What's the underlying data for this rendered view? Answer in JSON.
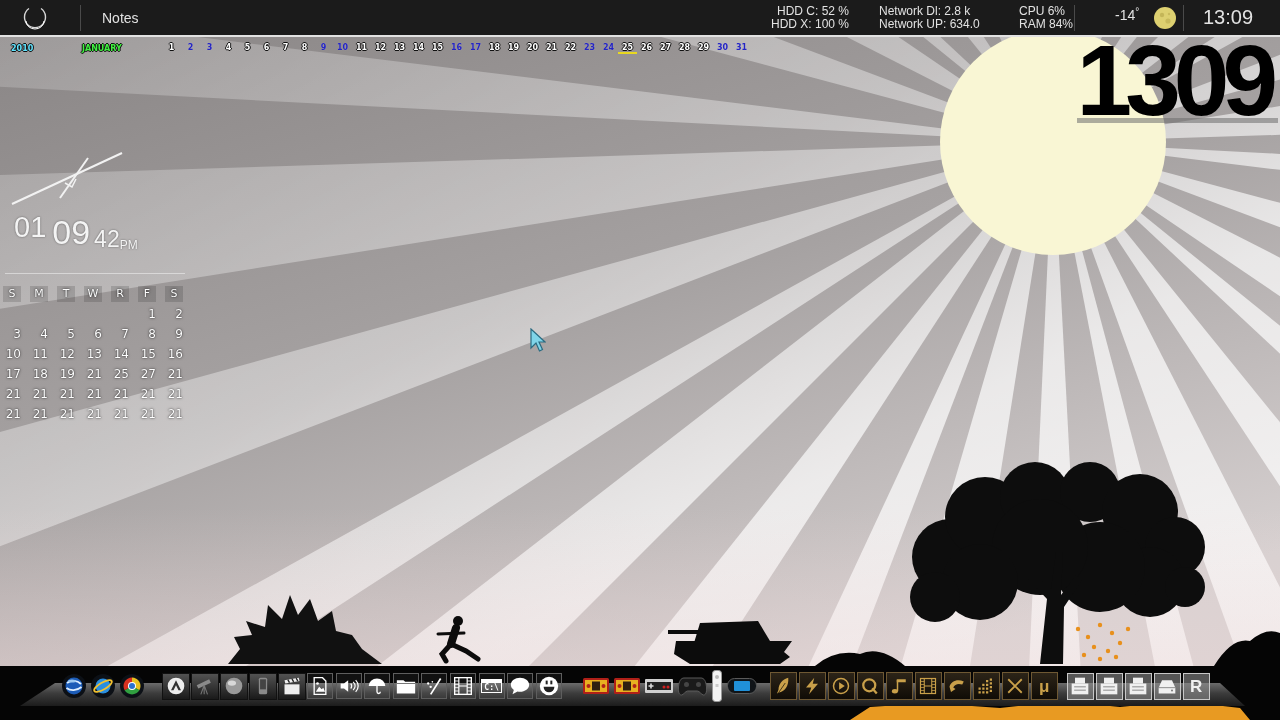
{
  "top_bar": {
    "title": "Notes",
    "stats": [
      {
        "lines": [
          "HDD C: 52 %",
          "HDD X: 100 %"
        ]
      },
      {
        "lines": [
          "Network Dl: 2.8 k",
          "Network UP: 634.0"
        ]
      },
      {
        "lines": [
          "CPU 6%",
          "RAM 84%"
        ]
      }
    ],
    "temperature": "-14$^{°}$",
    "time": "13:09"
  },
  "date_strip": {
    "year": "2010",
    "month": "JANUARY",
    "days": [
      {
        "label": "1",
        "weekend": false,
        "today": false
      },
      {
        "label": "2",
        "weekend": true,
        "today": false
      },
      {
        "label": "3",
        "weekend": true,
        "today": false
      },
      {
        "label": "4",
        "weekend": false,
        "today": false
      },
      {
        "label": "5",
        "weekend": false,
        "today": false
      },
      {
        "label": "6",
        "weekend": false,
        "today": false
      },
      {
        "label": "7",
        "weekend": false,
        "today": false
      },
      {
        "label": "8",
        "weekend": false,
        "today": false
      },
      {
        "label": "9",
        "weekend": true,
        "today": false
      },
      {
        "label": "10",
        "weekend": true,
        "today": false
      },
      {
        "label": "11",
        "weekend": false,
        "today": false
      },
      {
        "label": "12",
        "weekend": false,
        "today": false
      },
      {
        "label": "13",
        "weekend": false,
        "today": false
      },
      {
        "label": "14",
        "weekend": false,
        "today": false
      },
      {
        "label": "15",
        "weekend": false,
        "today": false
      },
      {
        "label": "16",
        "weekend": true,
        "today": false
      },
      {
        "label": "17",
        "weekend": true,
        "today": false
      },
      {
        "label": "18",
        "weekend": false,
        "today": false
      },
      {
        "label": "19",
        "weekend": false,
        "today": false
      },
      {
        "label": "20",
        "weekend": false,
        "today": false
      },
      {
        "label": "21",
        "weekend": false,
        "today": false
      },
      {
        "label": "22",
        "weekend": false,
        "today": false
      },
      {
        "label": "23",
        "weekend": true,
        "today": false
      },
      {
        "label": "24",
        "weekend": true,
        "today": false
      },
      {
        "label": "25",
        "weekend": false,
        "today": true
      },
      {
        "label": "26",
        "weekend": false,
        "today": false
      },
      {
        "label": "27",
        "weekend": false,
        "today": false
      },
      {
        "label": "28",
        "weekend": false,
        "today": false
      },
      {
        "label": "29",
        "weekend": false,
        "today": false
      },
      {
        "label": "30",
        "weekend": true,
        "today": false
      },
      {
        "label": "31",
        "weekend": true,
        "today": false
      }
    ]
  },
  "clock_widget": {
    "hour": "01",
    "minute": "09",
    "second": "42",
    "period": "PM"
  },
  "calendar": {
    "weekdays": [
      "S",
      "M",
      "T",
      "W",
      "R",
      "F",
      "S"
    ],
    "weeks": [
      [
        "1",
        "2"
      ],
      [
        "3",
        "4",
        "5",
        "6",
        "7",
        "8",
        "9"
      ],
      [
        "10",
        "11",
        "12",
        "13",
        "14",
        "15",
        "16"
      ],
      [
        "17",
        "18",
        "19",
        "21",
        "25",
        "27",
        "21"
      ],
      [
        "21",
        "21",
        "21",
        "21",
        "21",
        "21",
        "21"
      ],
      [
        "21",
        "21",
        "21",
        "21",
        "21",
        "21",
        "21"
      ]
    ]
  },
  "big_clock": "1309",
  "dock": {
    "groups": [
      {
        "kind": "orb",
        "items": [
          {
            "kind": "globe"
          },
          {
            "kind": "planet"
          },
          {
            "kind": "wheel"
          }
        ]
      },
      {
        "kind": "dark",
        "items": [
          {
            "kind": "chevron-disc"
          },
          {
            "kind": "telescope"
          },
          {
            "kind": "sphere"
          },
          {
            "kind": "phone"
          },
          {
            "kind": "clapperboard"
          }
        ]
      },
      {
        "kind": "outline",
        "items": [
          {
            "kind": "picture"
          },
          {
            "kind": "speaker"
          },
          {
            "kind": "umbrella"
          },
          {
            "kind": "folder"
          },
          {
            "kind": "wand"
          },
          {
            "kind": "film"
          },
          {
            "kind": "terminal",
            "label": "C:\\"
          },
          {
            "kind": "chat"
          },
          {
            "kind": "smiley"
          }
        ]
      },
      {
        "kind": "plain",
        "items": [
          {
            "kind": "handheld"
          },
          {
            "kind": "handheld"
          },
          {
            "kind": "pad"
          },
          {
            "kind": "gamepad"
          },
          {
            "kind": "remote"
          },
          {
            "kind": "psp"
          }
        ]
      },
      {
        "kind": "gold",
        "items": [
          {
            "kind": "feather"
          },
          {
            "kind": "bolt"
          },
          {
            "kind": "play"
          },
          {
            "kind": "magnifier"
          },
          {
            "kind": "note"
          },
          {
            "kind": "film"
          },
          {
            "kind": "curved-arrow"
          },
          {
            "kind": "grid"
          },
          {
            "kind": "cross"
          },
          {
            "kind": "text",
            "label": "μ"
          }
        ]
      },
      {
        "kind": "grey",
        "items": [
          {
            "kind": "printer"
          },
          {
            "kind": "printer"
          },
          {
            "kind": "printer"
          },
          {
            "kind": "drive"
          },
          {
            "kind": "text",
            "label": "R"
          }
        ]
      }
    ]
  }
}
